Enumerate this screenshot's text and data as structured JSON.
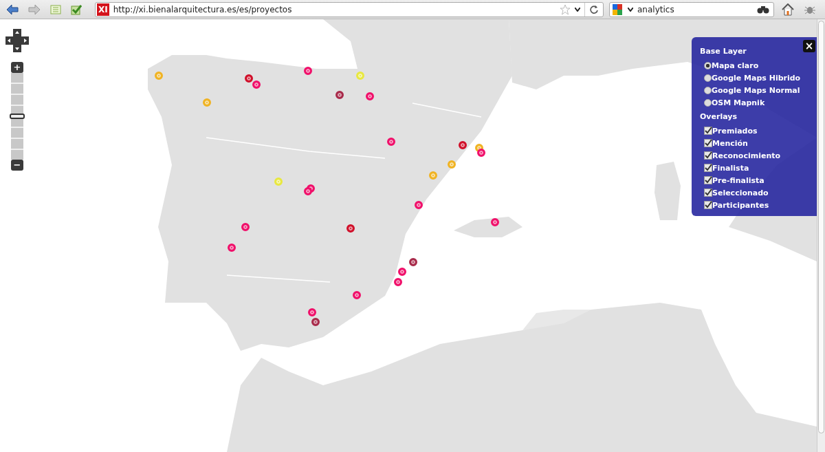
{
  "browser": {
    "favicon_text": "XI",
    "url": "http://xi.bienalarquitectura.es/es/proyectos",
    "search": "analytics"
  },
  "map": {
    "kind": "picture",
    "zoom": {
      "plus": "+",
      "minus": "−",
      "level": 0.5
    },
    "markers": [
      {
        "color": "#f0b323"
      },
      {
        "color": "#f0b323"
      },
      {
        "color": "#f0b323"
      },
      {
        "color": "#f0b323"
      },
      {
        "color": "#f0b323"
      },
      {
        "color": "#e8e840"
      },
      {
        "color": "#e8e840"
      },
      {
        "color": "#f0106a"
      },
      {
        "color": "#f0106a"
      },
      {
        "color": "#f0106a"
      },
      {
        "color": "#f0106a"
      },
      {
        "color": "#f0106a"
      },
      {
        "color": "#f0106a"
      },
      {
        "color": "#f0106a"
      },
      {
        "color": "#f0106a"
      },
      {
        "color": "#f0106a"
      },
      {
        "color": "#f0106a"
      },
      {
        "color": "#f0106a"
      },
      {
        "color": "#f0106a"
      },
      {
        "color": "#f0106a"
      },
      {
        "color": "#f0106a"
      },
      {
        "color": "#f0106a"
      },
      {
        "color": "#d0102a"
      },
      {
        "color": "#d0102a"
      },
      {
        "color": "#d0102a"
      },
      {
        "color": "#a82a4a"
      },
      {
        "color": "#a82a4a"
      },
      {
        "color": "#a82a4a"
      }
    ],
    "layer_switcher": {
      "close": "×",
      "base_layer_title": "Base Layer",
      "base_layers": [
        {
          "label": "Mapa claro",
          "selected": true
        },
        {
          "label": "Google Maps Hibrido",
          "selected": false
        },
        {
          "label": "Google Maps Normal",
          "selected": false
        },
        {
          "label": "OSM Mapnik",
          "selected": false
        }
      ],
      "overlays_title": "Overlays",
      "overlays": [
        {
          "label": "Premiados",
          "checked": true
        },
        {
          "label": "Mención",
          "checked": true
        },
        {
          "label": "Reconocimiento",
          "checked": true
        },
        {
          "label": "Finalista",
          "checked": true
        },
        {
          "label": "Pre-finalista",
          "checked": true
        },
        {
          "label": "Seleccionado",
          "checked": true
        },
        {
          "label": "Participantes",
          "checked": true
        }
      ]
    }
  }
}
